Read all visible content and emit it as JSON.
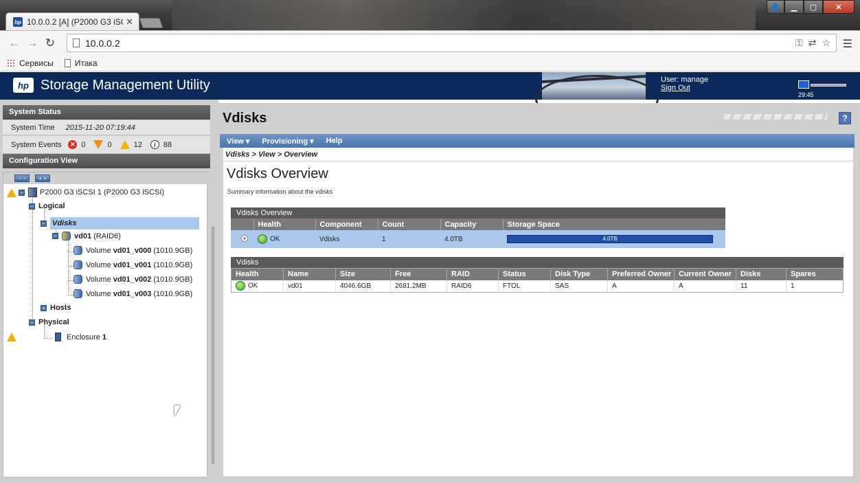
{
  "browser": {
    "tab_title": "10.0.0.2 [A] (P2000 G3 iSC",
    "favicon": "hp",
    "url": "10.0.0.2",
    "bookmarks": [
      {
        "label": "Сервисы",
        "icon": "apps-icon"
      },
      {
        "label": "Итака",
        "icon": "page-icon"
      }
    ]
  },
  "header": {
    "logo": "hp",
    "title": "Storage Management Utility",
    "user_label": "User: manage",
    "sign_out": "Sign Out",
    "time": "29:45"
  },
  "system_status": {
    "heading": "System Status",
    "time_label": "System Time",
    "time_value": "2015-11-20 07:19:44",
    "events_label": "System Events",
    "events": {
      "critical": "0",
      "error": "0",
      "warning": "12",
      "info": "88"
    }
  },
  "config_view": {
    "heading": "Configuration View",
    "collapse_label": "− −",
    "expand_label": "+ +",
    "root": "P2000 G3 iSCSI 1 (P2000 G3 iSCSI)",
    "logical": "Logical",
    "vdisks": "Vdisks",
    "vd_name": "vd01",
    "vd_raid": "(RAID6)",
    "volumes": [
      {
        "prefix": "Volume",
        "name": "vd01_v000",
        "size": "(1010.9GB)"
      },
      {
        "prefix": "Volume",
        "name": "vd01_v001",
        "size": "(1010.9GB)"
      },
      {
        "prefix": "Volume",
        "name": "vd01_v002",
        "size": "(1010.9GB)"
      },
      {
        "prefix": "Volume",
        "name": "vd01_v003",
        "size": "(1010.9GB)"
      }
    ],
    "hosts": "Hosts",
    "physical": "Physical",
    "enclosure_label": "Enclosure",
    "enclosure_num": "1"
  },
  "main": {
    "title": "Vdisks",
    "menu": [
      "View",
      "Provisioning",
      "Help"
    ],
    "breadcrumb": "Vdisks > View > Overview",
    "page_title": "Vdisks Overview",
    "subtitle": "Summary information about the vdisks"
  },
  "overview_table": {
    "caption": "Vdisks Overview",
    "columns": [
      "Health",
      "Component",
      "Count",
      "Capacity",
      "Storage Space"
    ],
    "row": {
      "health": "OK",
      "component": "Vdisks",
      "count": "1",
      "capacity": "4.0TB",
      "storage_space": "4.0TB"
    }
  },
  "vdisks_table": {
    "caption": "Vdisks",
    "columns": [
      "Health",
      "Name",
      "Size",
      "Free",
      "RAID",
      "Status",
      "Disk Type",
      "Preferred Owner",
      "Current Owner",
      "Disks",
      "Spares"
    ],
    "rows": [
      {
        "health": "OK",
        "name": "vd01",
        "size": "4046.6GB",
        "free": "2681.2MB",
        "raid": "RAID6",
        "status": "FTOL",
        "disk_type": "SAS",
        "preferred_owner": "A",
        "current_owner": "A",
        "disks": "11",
        "spares": "1"
      }
    ]
  }
}
